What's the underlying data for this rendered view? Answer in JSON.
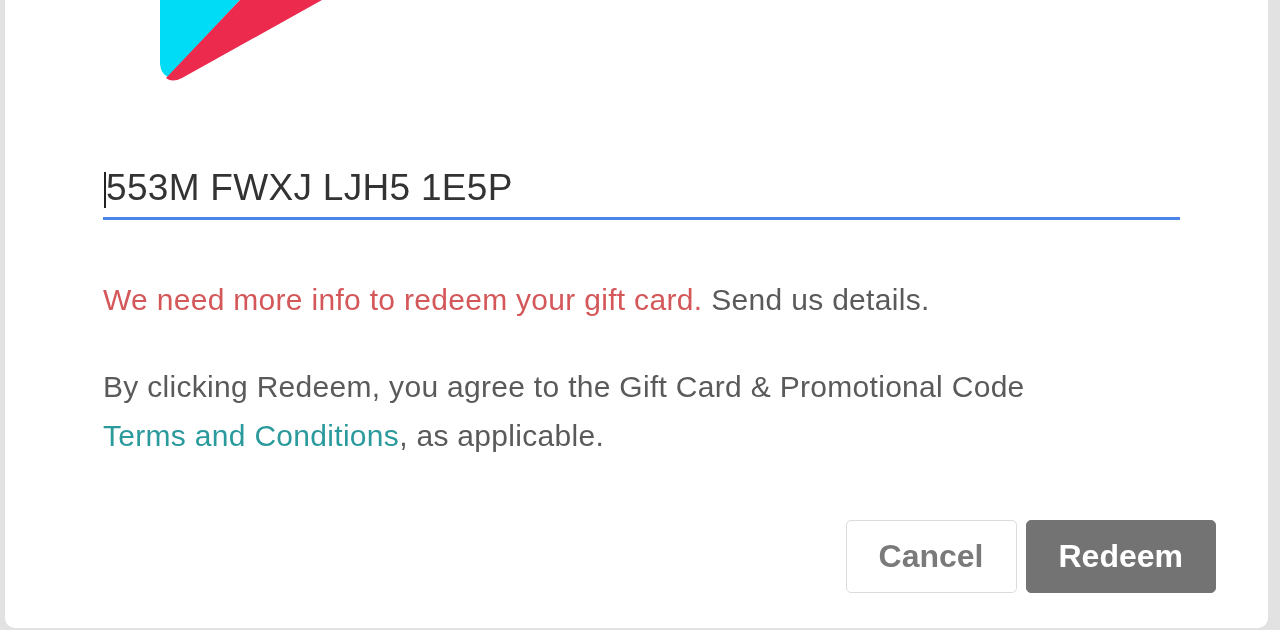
{
  "code_field": {
    "value": "553M FWXJ LJH5 1E5P",
    "focused": true
  },
  "error": {
    "message": "We need more info to redeem your gift card.",
    "action": "Send us details."
  },
  "terms": {
    "before": "By clicking Redeem, you agree to the Gift Card & Promotional Code",
    "link": "Terms and Conditions",
    "after": ", as applicable."
  },
  "buttons": [
    {
      "label": "Cancel",
      "kind": "secondary"
    },
    {
      "label": "Redeem",
      "kind": "primary"
    }
  ]
}
